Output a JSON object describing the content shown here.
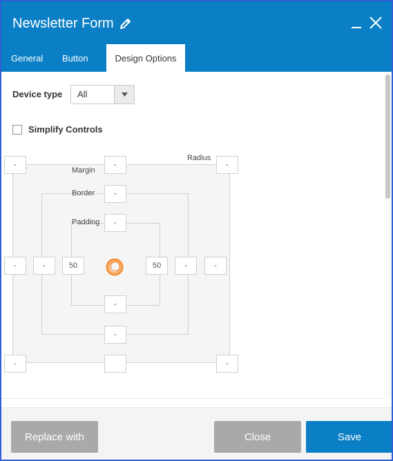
{
  "window": {
    "title": "Newsletter Form",
    "minimize_glyph": "_",
    "accent_color": "#0b7fc5"
  },
  "tabs": [
    {
      "label": "General"
    },
    {
      "label": "Button"
    },
    {
      "label": "Design Options",
      "active": true
    }
  ],
  "device": {
    "label": "Device type",
    "value": "All"
  },
  "simplify": {
    "label": "Simplify Controls",
    "checked": false
  },
  "box_model": {
    "margin_label": "Margin",
    "border_label": "Border",
    "padding_label": "Padding",
    "radius_label": "Radius",
    "radius_top_left": "-",
    "radius_top_right": "-",
    "radius_bottom_left": "-",
    "radius_bottom_right": "-",
    "margin_top": "-",
    "margin_left": "-",
    "margin_right": "-",
    "margin_bottom": "",
    "border_top": "-",
    "border_left": "-",
    "border_right": "-",
    "border_bottom": "-",
    "padding_top": "-",
    "padding_left": "50",
    "padding_right": "50",
    "padding_bottom": "-"
  },
  "footer": {
    "replace_label": "Replace with",
    "close_label": "Close",
    "save_label": "Save"
  }
}
